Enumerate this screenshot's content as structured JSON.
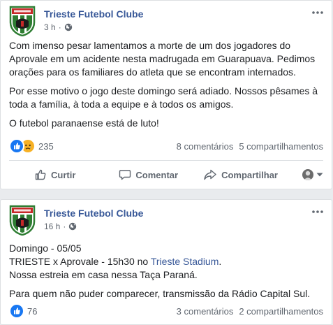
{
  "colors": {
    "link": "#385898",
    "secondary_text": "#606770",
    "like_blue": "#1877f2",
    "sad_yellow": "#f7b125"
  },
  "posts": [
    {
      "page_name": "Trieste Futebol Clube",
      "time": "3 h",
      "privacy_icon": "globe-icon",
      "paragraphs": [
        "Com imenso pesar lamentamos a morte de um dos jogadores do Aprovale em um acidente nesta madrugada em Guarapuava. Pedimos orações para os familiares do atleta que se encontram internados.",
        "Por esse motivo o jogo deste domingo será adiado. Nossos pêsames à toda a família, à toda a equipe e à todos os amigos.",
        "O futebol paranaense está de luto!"
      ],
      "reactions": [
        "like-icon",
        "sad-icon"
      ],
      "reaction_count": "235",
      "comments": "8 comentários",
      "shares": "5 compartilhamentos",
      "actions": {
        "like": "Curtir",
        "comment": "Comentar",
        "share": "Compartilhar"
      }
    },
    {
      "page_name": "Trieste Futebol Clube",
      "time": "16 h",
      "privacy_icon": "globe-icon",
      "lines": {
        "line1": "Domingo - 05/05",
        "line2_prefix": "TRIESTE x Aprovale - 15h30 no ",
        "line2_link": "Trieste Stadium",
        "line2_suffix": ".",
        "line3": "Nossa estreia em casa nessa Taça Paraná.",
        "line4": "Para quem não puder comparecer, transmissão da Rádio Capital Sul."
      },
      "reactions": [
        "like-icon"
      ],
      "reaction_count": "76",
      "comments": "3 comentários",
      "shares": "2 compartilhamentos"
    }
  ]
}
